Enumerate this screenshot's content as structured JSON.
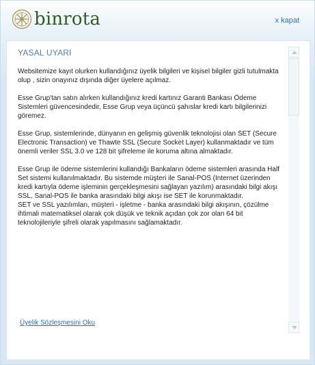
{
  "brand": {
    "name": "binrota"
  },
  "header": {
    "close_label": "x kapat"
  },
  "notice": {
    "title": "YASAL UYARI",
    "paragraphs": [
      "Websitemize kayıt olurken kullandığınız üyelik bilgileri ve kişisel bilgiler gizli tutulmakta olup , sizin onayınız dışında diğer üyelere açılmaz.",
      "Esse Grup'tan satın alırken kullandığınız kredi kartınız Garanti Bankası Ödeme Sistemleri güvencesindedir, Esse Grup veya üçüncü şahıslar kredi kartı bilgilerinizi göremez.",
      "Esse Grup, sistemlerinde, dünyanın en gelişmiş güvenlik teknolojisi olan SET (Secure Electronic Transaction) ve Thawte SSL (Secure Socket Layer) kullanmaktadır ve tüm önemli veriler SSL 3.0 ve 128 bit şifreleme ile koruma altına almaktadır.",
      "Esse Grup ile ödeme sistemlerini kullandığı Bankaların ödeme sistemleri arasında Half Set sistemi kullanılmaktadır. Bu sistemde müşteri ile Sanal-POS (Internet üzerinden kredi kartıyla ödeme işleminin gerçekleşmesini sağlayan yazılım) arasındaki bilgi akışı SSL, Sanal-POS ile banka arasındaki bilgi akışı ise SET ile korunmaktadır.",
      "SET ve SSL yazılımları, müşteri - işletme - banka arasındaki bilgi akışının, çözülme ihtimali matematiksel olarak çok düşük ve teknik açıdan çok zor olan 64 bit teknolojileriyle şifreli olarak yapılmasını sağlamaktadır."
    ]
  },
  "footer": {
    "agreement_link": "Üyelik Sözleşmesini Oku"
  },
  "icons": {
    "logo": "binrota-logo-icon",
    "scroll_up": "arrow-up-icon",
    "scroll_down": "arrow-down-icon"
  },
  "colors": {
    "brand_green": "#2f5d1e",
    "link_blue": "#2a6fb0",
    "title_blue": "#4f7bb0",
    "background": "#d9e8f4"
  }
}
